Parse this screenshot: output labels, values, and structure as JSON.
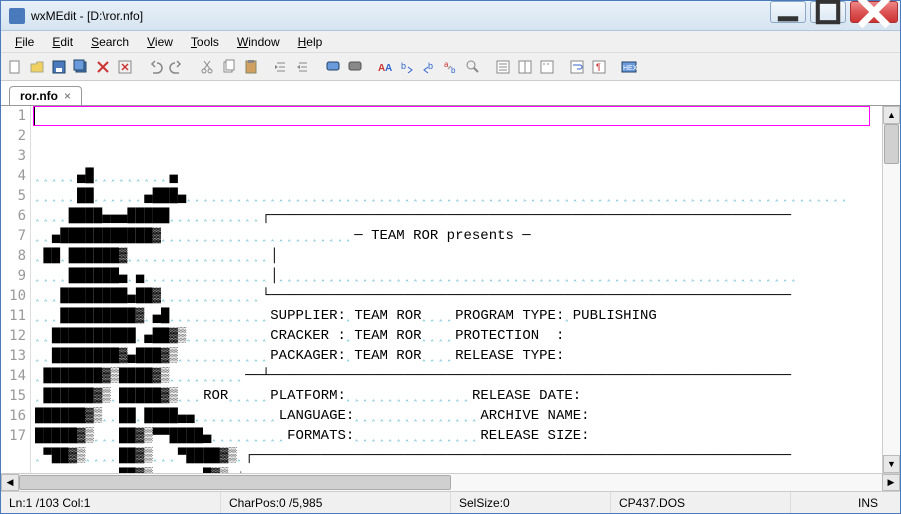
{
  "window": {
    "title": "wxMEdit - [D:\\ror.nfo]"
  },
  "menu": {
    "file": "File",
    "edit": "Edit",
    "search": "Search",
    "view": "View",
    "tools": "Tools",
    "window": "Window",
    "help": "Help"
  },
  "tabs": {
    "active": {
      "name": "ror.nfo"
    }
  },
  "gutter": {
    "lines": [
      "1",
      "2",
      "3",
      "4",
      "5",
      "6",
      "7",
      "8",
      "9",
      "10",
      "11",
      "12",
      "13",
      "14",
      "15",
      "16",
      "17"
    ]
  },
  "nfo": {
    "banner": "─ TEAM ROR presents ─",
    "fields": {
      "supplier_l": "SUPPLIER:",
      "supplier_v": "TEAM ROR",
      "program_type_l": "PROGRAM TYPE:",
      "program_type_v": "PUBLISHING",
      "cracker_l": "CRACKER :",
      "cracker_v": "TEAM ROR",
      "protection_l": "PROTECTION  :",
      "packager_l": "PACKAGER:",
      "packager_v": "TEAM ROR",
      "release_type_l": "RELEASE TYPE:",
      "ror": "ROR",
      "platform_l": "PLATFORM:",
      "release_date_l": "RELEASE DATE:",
      "language_l": "LANGUAGE:",
      "archive_name_l": "ARCHIVE NAME:",
      "formats_l": "FORMATS:",
      "release_size_l": "RELEASE SIZE:"
    }
  },
  "status": {
    "line": "Ln:1 /103 Col:1",
    "charpos": "CharPos:0 /5,985",
    "selsize": "SelSize:0",
    "encoding": "CP437.DOS",
    "ins": "INS"
  },
  "colors": {
    "current_line_border": "#ff00ff",
    "whitespace": "#6ec0d0"
  }
}
